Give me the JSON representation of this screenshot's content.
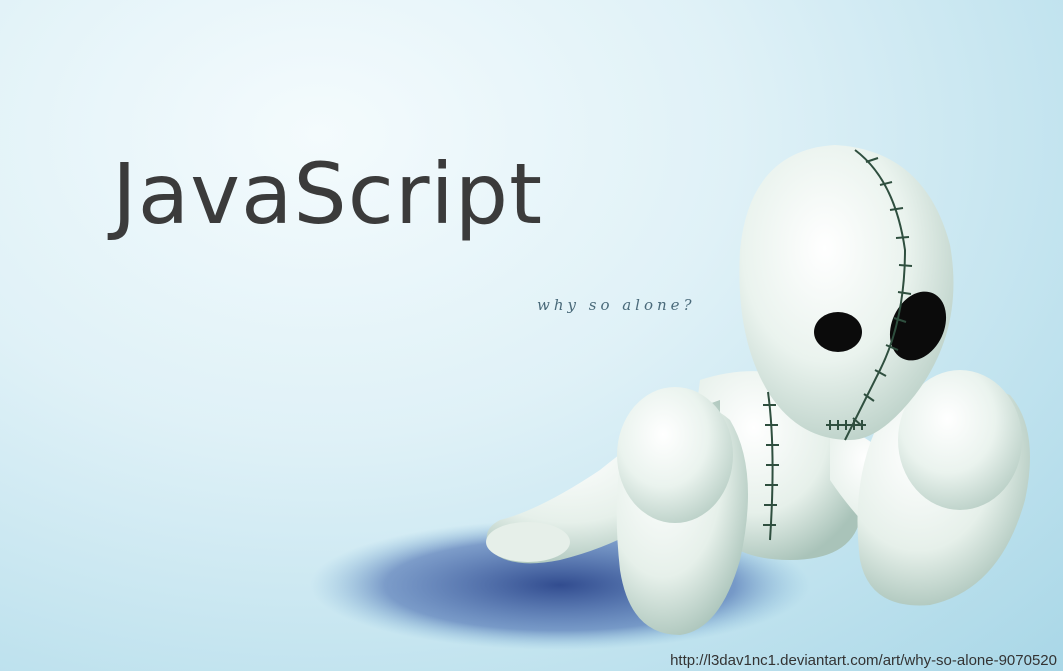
{
  "title": "JavaScript",
  "tagline": "why so alone?",
  "credit_url": "http://l3dav1nc1.deviantart.com/art/why-so-alone-9070520",
  "colors": {
    "background": "#c8e8f2",
    "title_text": "#3b3b3b",
    "doll_body": "#eef5ef",
    "shadow": "#1d3a8a"
  },
  "illustration": {
    "subject": "sad-stitched-doll",
    "description_icon": "doll-figure-icon"
  }
}
